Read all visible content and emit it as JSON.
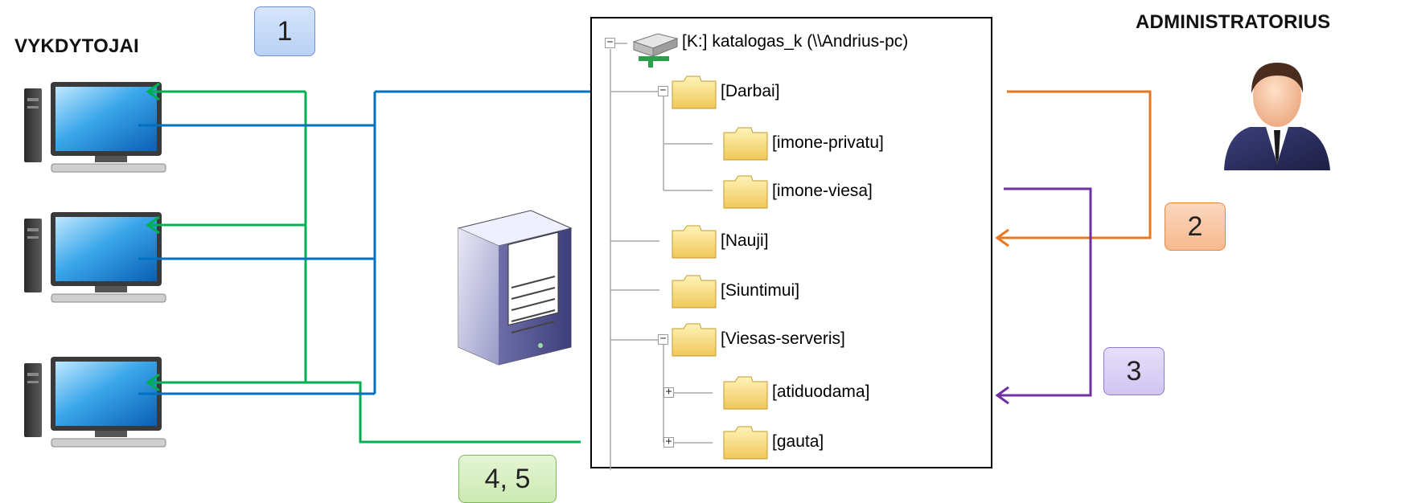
{
  "labels": {
    "executors": "VYKDYTOJAI",
    "administrator": "ADMINISTRATORIUS"
  },
  "badges": {
    "b1": "1",
    "b2": "2",
    "b3": "3",
    "b45": "4, 5"
  },
  "tree": {
    "root": "[K:]  katalogas_k (\\\\Andrius-pc)",
    "darbai": "[Darbai]",
    "imone_privatu": "[imone-privatu]",
    "imone_viesa": "[imone-viesa]",
    "nauji": "[Nauji]",
    "siuntimui": "[Siuntimui]",
    "viesas_serveris": "[Viesas-serveris]",
    "atiduodama": "[atiduodama]",
    "gauta": "[gauta]"
  },
  "colors": {
    "green": "#00b050",
    "blue": "#0070c0",
    "orange": "#e87722",
    "purple": "#7030a0"
  }
}
